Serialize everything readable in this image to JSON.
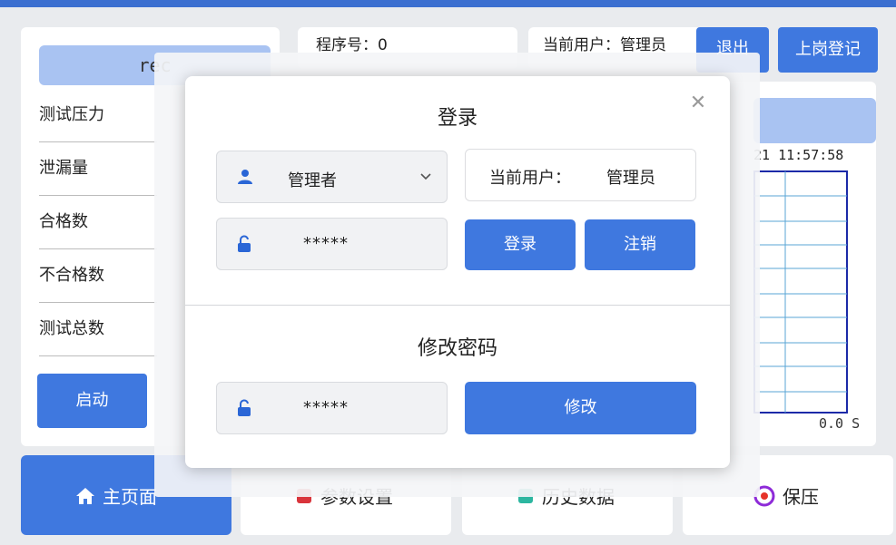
{
  "left_panel": {
    "rec_label": "rec",
    "rows": [
      "测试压力",
      "泄漏量",
      "合格数",
      "不合格数",
      "测试总数"
    ],
    "start_label": "启动"
  },
  "header": {
    "program_text": "程序号：0",
    "current_user_text": "当前用户：管理员",
    "exit_label": "退出",
    "post_login_label": "上岗登记"
  },
  "chart": {
    "time_text": "21  11:57:58",
    "x_value_text": "0.0 S"
  },
  "bottom_nav": {
    "home_label": "主页面",
    "params_label": "参数设置",
    "history_label": "历史数据",
    "hold_label": "保压"
  },
  "modal": {
    "title": "登录",
    "user_select_value": "管理者",
    "password_value": "*****",
    "current_user_label": "当前用户：",
    "current_user_value": "管理员",
    "login_label": "登录",
    "logout_label": "注销",
    "change_password_title": "修改密码",
    "new_password_value": "*****",
    "modify_label": "修改"
  },
  "colors": {
    "primary": "#3f78df",
    "chip": "#a9c3f2",
    "chart_line": "#1c2aa8",
    "grid": "#5aa6d6"
  }
}
